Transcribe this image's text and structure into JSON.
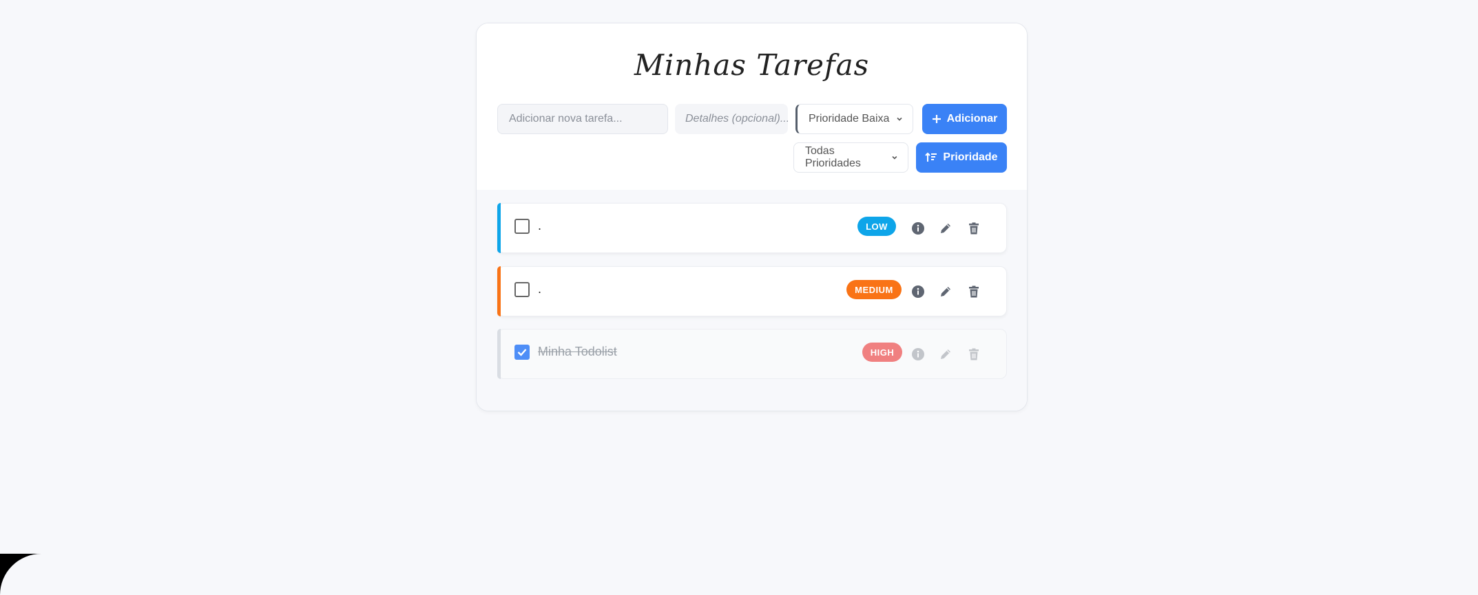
{
  "app": {
    "title": "Minhas Tarefas"
  },
  "form": {
    "task_placeholder": "Adicionar nova tarefa...",
    "details_placeholder": "Detalhes (opcional)...",
    "priority_selected": "Prioridade Baixa",
    "add_button": "Adicionar",
    "filter_selected": "Todas Prioridades",
    "sort_button": "Prioridade"
  },
  "tasks": [
    {
      "text": ".",
      "priority": "LOW",
      "color": "#0ea5e9",
      "completed": false
    },
    {
      "text": ".",
      "priority": "MEDIUM",
      "color": "#f97316",
      "completed": false
    },
    {
      "text": "Minha Todolist",
      "priority": "HIGH",
      "color": "#f08080",
      "completed": true
    }
  ],
  "colors": {
    "accent": "#3a82f6",
    "background": "#f7f8fb"
  }
}
